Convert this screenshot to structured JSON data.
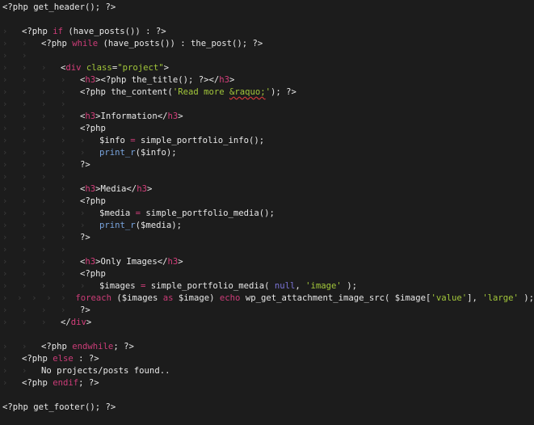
{
  "editor": {
    "background": "#1c1c1c",
    "colors": {
      "plain": "#e8e8e8",
      "keyword": "#cc3c78",
      "tag": "#d63f7c",
      "string": "#a2c63a",
      "function": "#7aa6e0",
      "constant": "#7a73d6"
    },
    "lines": [
      {
        "indent": 0,
        "tokens": [
          {
            "t": "<?php get_header(); ?>",
            "c": "plain"
          }
        ]
      },
      {
        "indent": 0,
        "tokens": []
      },
      {
        "indent": 1,
        "tokens": [
          {
            "t": "<?php ",
            "c": "plain"
          },
          {
            "t": "if",
            "c": "keyword"
          },
          {
            "t": " (have_posts()) : ?>",
            "c": "plain"
          }
        ]
      },
      {
        "indent": 2,
        "tokens": [
          {
            "t": "<?php ",
            "c": "plain"
          },
          {
            "t": "while",
            "c": "keyword"
          },
          {
            "t": " (have_posts()) : the_post(); ?>",
            "c": "plain"
          }
        ]
      },
      {
        "indent": 2,
        "tokens": []
      },
      {
        "indent": 3,
        "tokens": [
          {
            "t": "<",
            "c": "plain"
          },
          {
            "t": "div",
            "c": "tag"
          },
          {
            "t": " class",
            "c": "attr"
          },
          {
            "t": "=",
            "c": "plain"
          },
          {
            "t": "\"project\"",
            "c": "string"
          },
          {
            "t": ">",
            "c": "plain"
          }
        ]
      },
      {
        "indent": 4,
        "tokens": [
          {
            "t": "<",
            "c": "plain"
          },
          {
            "t": "h3",
            "c": "tag"
          },
          {
            "t": "><?php the_title(); ?></",
            "c": "plain"
          },
          {
            "t": "h3",
            "c": "tag"
          },
          {
            "t": ">",
            "c": "plain"
          }
        ]
      },
      {
        "indent": 4,
        "tokens": [
          {
            "t": "<?php the_content(",
            "c": "plain"
          },
          {
            "t": "'Read more ",
            "c": "string"
          },
          {
            "t": "&raquo;",
            "c": "entity"
          },
          {
            "t": "'",
            "c": "string"
          },
          {
            "t": "); ?>",
            "c": "plain"
          }
        ]
      },
      {
        "indent": 4,
        "tokens": []
      },
      {
        "indent": 4,
        "tokens": [
          {
            "t": "<",
            "c": "plain"
          },
          {
            "t": "h3",
            "c": "tag"
          },
          {
            "t": ">Information</",
            "c": "plain"
          },
          {
            "t": "h3",
            "c": "tag"
          },
          {
            "t": ">",
            "c": "plain"
          }
        ]
      },
      {
        "indent": 4,
        "tokens": [
          {
            "t": "<?php",
            "c": "plain"
          }
        ]
      },
      {
        "indent": 5,
        "tokens": [
          {
            "t": "$info ",
            "c": "plain"
          },
          {
            "t": "=",
            "c": "op"
          },
          {
            "t": " simple_portfolio_info();",
            "c": "plain"
          }
        ]
      },
      {
        "indent": 5,
        "tokens": [
          {
            "t": "print_r",
            "c": "func"
          },
          {
            "t": "($info);",
            "c": "plain"
          }
        ]
      },
      {
        "indent": 4,
        "tokens": [
          {
            "t": "?>",
            "c": "plain"
          }
        ]
      },
      {
        "indent": 4,
        "tokens": []
      },
      {
        "indent": 4,
        "tokens": [
          {
            "t": "<",
            "c": "plain"
          },
          {
            "t": "h3",
            "c": "tag"
          },
          {
            "t": ">Media</",
            "c": "plain"
          },
          {
            "t": "h3",
            "c": "tag"
          },
          {
            "t": ">",
            "c": "plain"
          }
        ]
      },
      {
        "indent": 4,
        "tokens": [
          {
            "t": "<?php",
            "c": "plain"
          }
        ]
      },
      {
        "indent": 5,
        "tokens": [
          {
            "t": "$media ",
            "c": "plain"
          },
          {
            "t": "=",
            "c": "op"
          },
          {
            "t": " simple_portfolio_media();",
            "c": "plain"
          }
        ]
      },
      {
        "indent": 5,
        "tokens": [
          {
            "t": "print_r",
            "c": "func"
          },
          {
            "t": "($media);",
            "c": "plain"
          }
        ]
      },
      {
        "indent": 4,
        "tokens": [
          {
            "t": "?>",
            "c": "plain"
          }
        ]
      },
      {
        "indent": 4,
        "tokens": []
      },
      {
        "indent": 4,
        "tokens": [
          {
            "t": "<",
            "c": "plain"
          },
          {
            "t": "h3",
            "c": "tag"
          },
          {
            "t": ">Only Images</",
            "c": "plain"
          },
          {
            "t": "h3",
            "c": "tag"
          },
          {
            "t": ">",
            "c": "plain"
          }
        ]
      },
      {
        "indent": 4,
        "tokens": [
          {
            "t": "<?php",
            "c": "plain"
          }
        ]
      },
      {
        "indent": 5,
        "tokens": [
          {
            "t": "$images ",
            "c": "plain"
          },
          {
            "t": "=",
            "c": "op"
          },
          {
            "t": " simple_portfolio_media( ",
            "c": "plain"
          },
          {
            "t": "null",
            "c": "null"
          },
          {
            "t": ", ",
            "c": "plain"
          },
          {
            "t": "'image'",
            "c": "string"
          },
          {
            "t": " );",
            "c": "plain"
          }
        ]
      },
      {
        "indent": 5,
        "tokens": [
          {
            "t": "foreach",
            "c": "keyword"
          },
          {
            "t": " ($images ",
            "c": "plain"
          },
          {
            "t": "as",
            "c": "keyword"
          },
          {
            "t": " $image) ",
            "c": "plain"
          },
          {
            "t": "echo",
            "c": "keyword"
          },
          {
            "t": " wp_get_attachment_image_src( $image[",
            "c": "plain"
          },
          {
            "t": "'value'",
            "c": "string"
          },
          {
            "t": "], ",
            "c": "plain"
          },
          {
            "t": "'large'",
            "c": "string"
          },
          {
            "t": " );",
            "c": "plain"
          }
        ]
      },
      {
        "indent": 4,
        "tokens": [
          {
            "t": "?>",
            "c": "plain"
          }
        ]
      },
      {
        "indent": 3,
        "tokens": [
          {
            "t": "</",
            "c": "plain"
          },
          {
            "t": "div",
            "c": "tag"
          },
          {
            "t": ">",
            "c": "plain"
          }
        ]
      },
      {
        "indent": 0,
        "tokens": []
      },
      {
        "indent": 2,
        "tokens": [
          {
            "t": "<?php ",
            "c": "plain"
          },
          {
            "t": "endwhile",
            "c": "keyword"
          },
          {
            "t": "; ?>",
            "c": "plain"
          }
        ]
      },
      {
        "indent": 1,
        "tokens": [
          {
            "t": "<?php ",
            "c": "plain"
          },
          {
            "t": "else",
            "c": "keyword"
          },
          {
            "t": " : ?>",
            "c": "plain"
          }
        ]
      },
      {
        "indent": 2,
        "tokens": [
          {
            "t": "No projects/posts found..",
            "c": "plain"
          }
        ]
      },
      {
        "indent": 1,
        "tokens": [
          {
            "t": "<?php ",
            "c": "plain"
          },
          {
            "t": "endif",
            "c": "keyword"
          },
          {
            "t": "; ?>",
            "c": "plain"
          }
        ]
      },
      {
        "indent": 0,
        "tokens": []
      },
      {
        "indent": 0,
        "tokens": [
          {
            "t": "<?php get_footer(); ?>",
            "c": "plain"
          }
        ]
      }
    ]
  }
}
